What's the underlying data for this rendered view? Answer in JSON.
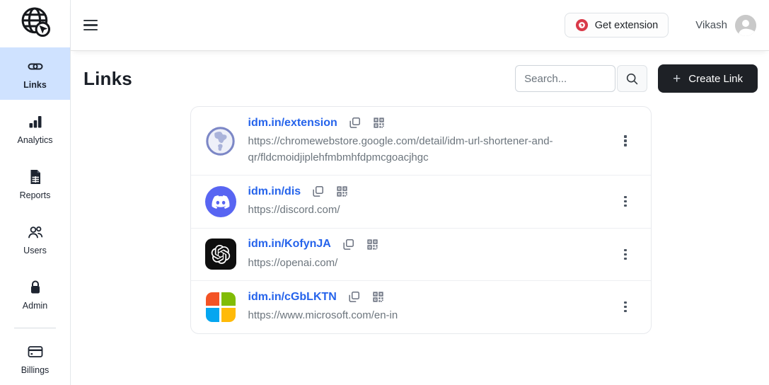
{
  "topbar": {
    "get_extension_label": "Get extension",
    "user_name": "Vikash"
  },
  "sidebar": {
    "items": [
      {
        "label": "Links",
        "icon": "link-icon",
        "active": true
      },
      {
        "label": "Analytics",
        "icon": "bar-chart-icon",
        "active": false
      },
      {
        "label": "Reports",
        "icon": "report-file-icon",
        "active": false
      },
      {
        "label": "Users",
        "icon": "users-icon",
        "active": false
      },
      {
        "label": "Admin",
        "icon": "lock-icon",
        "active": false
      },
      {
        "label": "Billings",
        "icon": "credit-card-icon",
        "active": false
      }
    ]
  },
  "main": {
    "title": "Links",
    "search_placeholder": "Search...",
    "create_link_plus": "+",
    "create_link_label": "Create Link",
    "links": [
      {
        "short_url": "idm.in/extension",
        "destination_url": "https://chromewebstore.google.com/detail/idm-url-shortener-and-qr/fldcmoidjiplehfmbmhfdpmcgoacjhgc",
        "favicon": "globe-favicon"
      },
      {
        "short_url": "idm.in/dis",
        "destination_url": "https://discord.com/",
        "favicon": "discord-favicon"
      },
      {
        "short_url": "idm.in/KofynJA",
        "destination_url": "https://openai.com/",
        "favicon": "openai-favicon"
      },
      {
        "short_url": "idm.in/cGbLKTN",
        "destination_url": "https://www.microsoft.com/en-in",
        "favicon": "microsoft-favicon"
      }
    ]
  },
  "colors": {
    "active_item_bg": "#cfe2ff",
    "link_blue": "#2563eb",
    "dest_gray": "#6c757d",
    "create_button_bg": "#1e2126",
    "extension_icon_red": "#d93a49",
    "discord_blurple": "#5865f2",
    "microsoft_red": "#f35325",
    "microsoft_green": "#81bc06",
    "microsoft_blue": "#05a6f0",
    "microsoft_yellow": "#ffba08"
  }
}
